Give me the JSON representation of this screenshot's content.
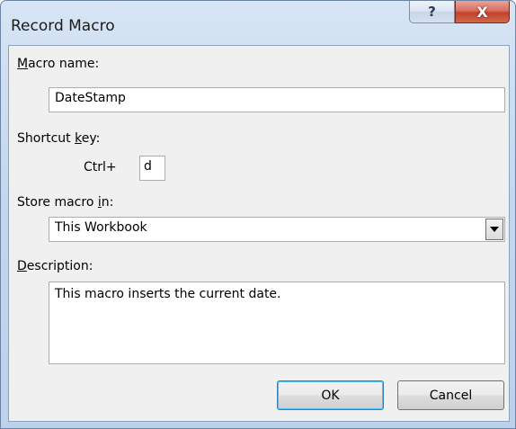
{
  "window": {
    "title": "Record Macro",
    "help_glyph": "?",
    "close_glyph": "X"
  },
  "form": {
    "macro_name": {
      "label_mnemonic": "M",
      "label_rest": "acro name:",
      "value": "DateStamp"
    },
    "shortcut": {
      "label_pre": "Shortcut ",
      "label_mnemonic": "k",
      "label_post": "ey:",
      "prefix": "Ctrl+",
      "value": "d"
    },
    "store": {
      "label_pre": "Store macro ",
      "label_mnemonic": "i",
      "label_post": "n:",
      "selected": "This Workbook"
    },
    "description": {
      "label_mnemonic": "D",
      "label_rest": "escription:",
      "value": "This macro inserts the current date."
    }
  },
  "buttons": {
    "ok": "OK",
    "cancel": "Cancel"
  }
}
